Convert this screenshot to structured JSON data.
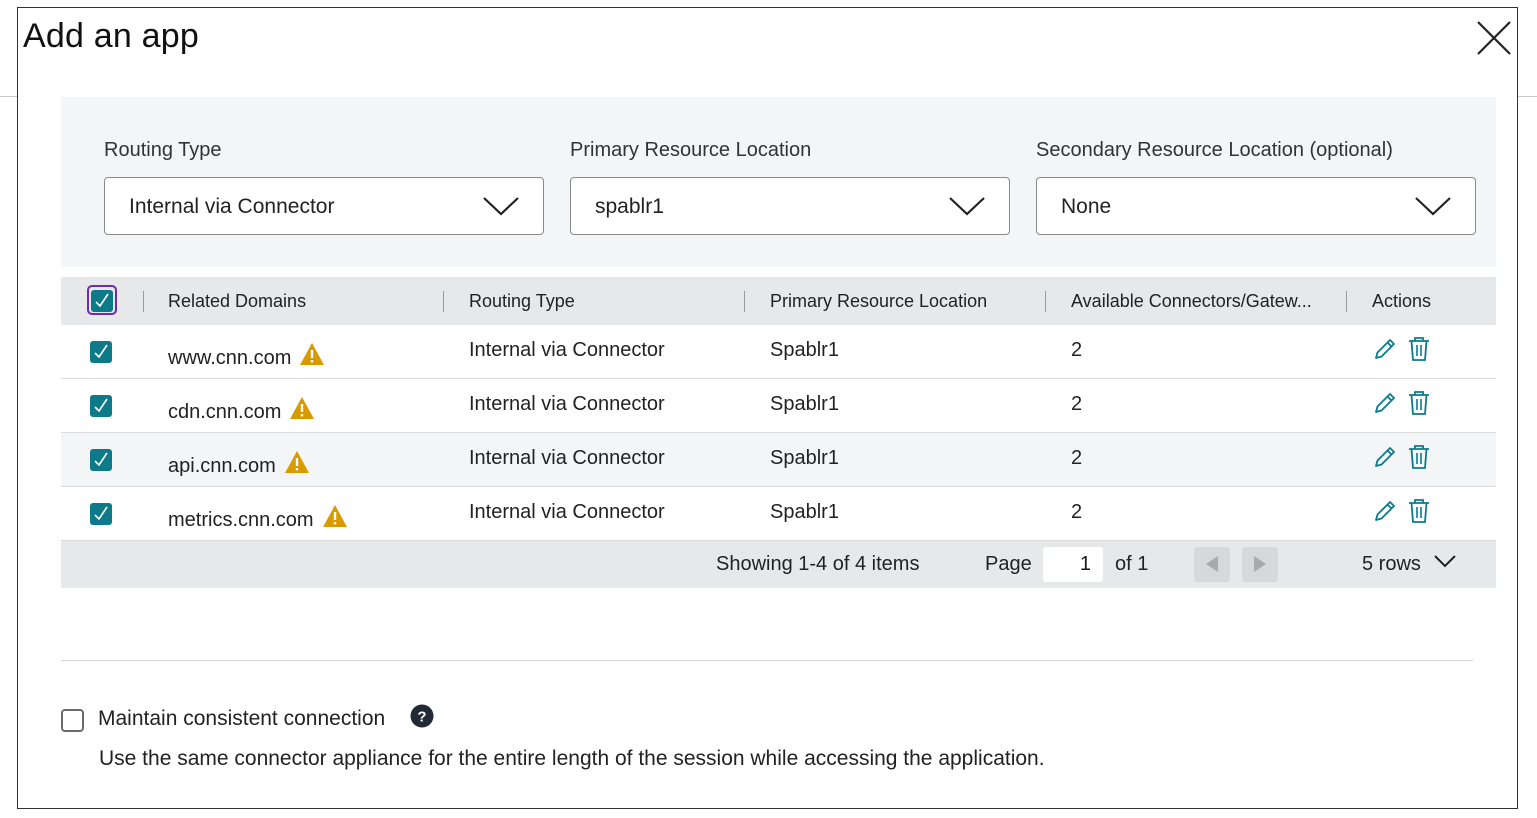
{
  "dialog": {
    "title": "Add an app"
  },
  "filters": {
    "routing_type": {
      "label": "Routing Type",
      "value": "Internal via Connector"
    },
    "primary_location": {
      "label": "Primary Resource Location",
      "value": "spablr1"
    },
    "secondary_location": {
      "label": "Secondary Resource Location (optional)",
      "value": "None"
    }
  },
  "table": {
    "columns": [
      "Related Domains",
      "Routing Type",
      "Primary Resource Location",
      "Available Connectors/Gatew...",
      "Actions"
    ],
    "rows": [
      {
        "domain": "www.cnn.com",
        "routing": "Internal via Connector",
        "location": "Spablr1",
        "connectors": "2",
        "checked": true,
        "warning": true
      },
      {
        "domain": "cdn.cnn.com",
        "routing": "Internal via Connector",
        "location": "Spablr1",
        "connectors": "2",
        "checked": true,
        "warning": true
      },
      {
        "domain": "api.cnn.com",
        "routing": "Internal via Connector",
        "location": "Spablr1",
        "connectors": "2",
        "checked": true,
        "warning": true
      },
      {
        "domain": "metrics.cnn.com",
        "routing": "Internal via Connector",
        "location": "Spablr1",
        "connectors": "2",
        "checked": true,
        "warning": true
      }
    ]
  },
  "pagination": {
    "showing": "Showing 1-4 of 4 items",
    "page_label": "Page",
    "page_value": "1",
    "of_label": "of 1",
    "rows_label": "5 rows"
  },
  "option": {
    "label": "Maintain consistent connection",
    "description": "Use the same connector appliance for the entire length of the session while accessing the application.",
    "checked": false
  },
  "colors": {
    "checkbox": "#0d7a8a",
    "warning": "#d99a00",
    "focus": "#6b2bb3"
  },
  "icons": [
    "close-icon",
    "chevron-down-icon",
    "check-icon",
    "warning-icon",
    "edit-icon",
    "delete-icon",
    "prev-page-icon",
    "next-page-icon",
    "help-icon"
  ]
}
